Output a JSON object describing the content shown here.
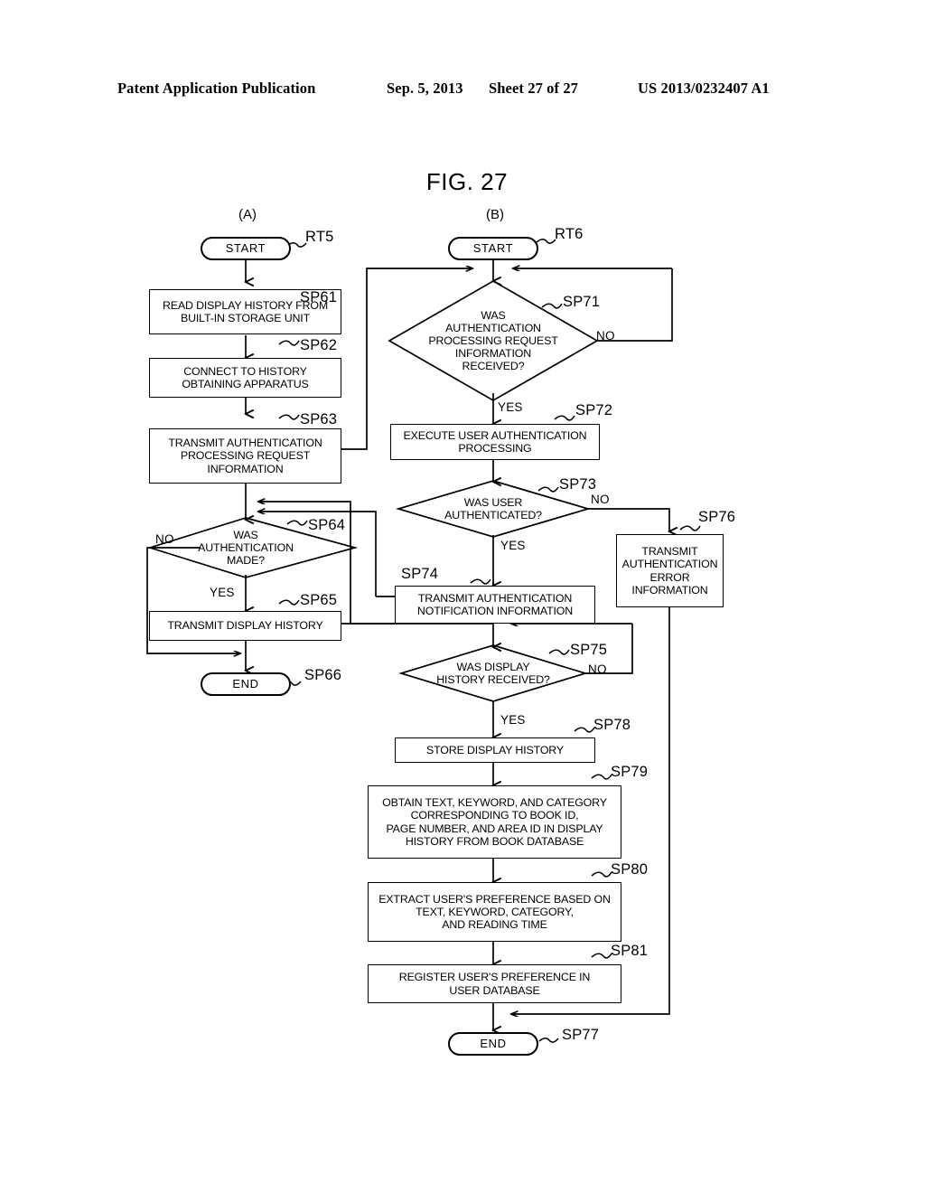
{
  "header": {
    "publication": "Patent Application Publication",
    "date": "Sep. 5, 2013",
    "sheet": "Sheet 27 of 27",
    "number": "US 2013/0232407 A1"
  },
  "figure": {
    "title": "FIG. 27",
    "panel_a_label": "(A)",
    "panel_b_label": "(B)"
  },
  "panel_a": {
    "routine_tag": "RT5",
    "start": "START",
    "end": "END",
    "steps": [
      {
        "tag": "SP61",
        "text": "READ DISPLAY HISTORY FROM\nBUILT-IN STORAGE UNIT"
      },
      {
        "tag": "SP62",
        "text": "CONNECT TO HISTORY\nOBTAINING APPARATUS"
      },
      {
        "tag": "SP63",
        "text": "TRANSMIT AUTHENTICATION\nPROCESSING REQUEST\nINFORMATION"
      },
      {
        "tag": "SP64",
        "text": "WAS\nAUTHENTICATION\nMADE?"
      },
      {
        "tag": "SP65",
        "text": "TRANSMIT DISPLAY HISTORY"
      },
      {
        "tag": "SP66",
        "text": "END"
      }
    ],
    "branches": {
      "sp64_no": "NO",
      "sp64_yes": "YES"
    }
  },
  "panel_b": {
    "routine_tag": "RT6",
    "start": "START",
    "end": "END",
    "steps": [
      {
        "tag": "SP71",
        "text": "WAS\nAUTHENTICATION\nPROCESSING REQUEST\nINFORMATION\nRECEIVED?"
      },
      {
        "tag": "SP72",
        "text": "EXECUTE USER AUTHENTICATION\nPROCESSING"
      },
      {
        "tag": "SP73",
        "text": "WAS USER\nAUTHENTICATED?"
      },
      {
        "tag": "SP74",
        "text": "TRANSMIT AUTHENTICATION\nNOTIFICATION INFORMATION"
      },
      {
        "tag": "SP75",
        "text": "WAS DISPLAY\nHISTORY RECEIVED?"
      },
      {
        "tag": "SP76",
        "text": "TRANSMIT\nAUTHENTICATION\nERROR\nINFORMATION"
      },
      {
        "tag": "SP77",
        "text": "END"
      },
      {
        "tag": "SP78",
        "text": "STORE DISPLAY HISTORY"
      },
      {
        "tag": "SP79",
        "text": "OBTAIN TEXT, KEYWORD, AND CATEGORY\nCORRESPONDING TO BOOK ID,\nPAGE NUMBER, AND AREA ID IN DISPLAY\nHISTORY FROM BOOK DATABASE"
      },
      {
        "tag": "SP80",
        "text": "EXTRACT USER'S PREFERENCE BASED ON\nTEXT, KEYWORD, CATEGORY,\nAND READING TIME"
      },
      {
        "tag": "SP81",
        "text": "REGISTER USER'S PREFERENCE IN\nUSER DATABASE"
      }
    ],
    "branches": {
      "sp71_no": "NO",
      "sp71_yes": "YES",
      "sp73_no": "NO",
      "sp73_yes": "YES",
      "sp75_no": "NO",
      "sp75_yes": "YES"
    }
  },
  "colors": {
    "ink": "#000000",
    "paper": "#ffffff"
  }
}
